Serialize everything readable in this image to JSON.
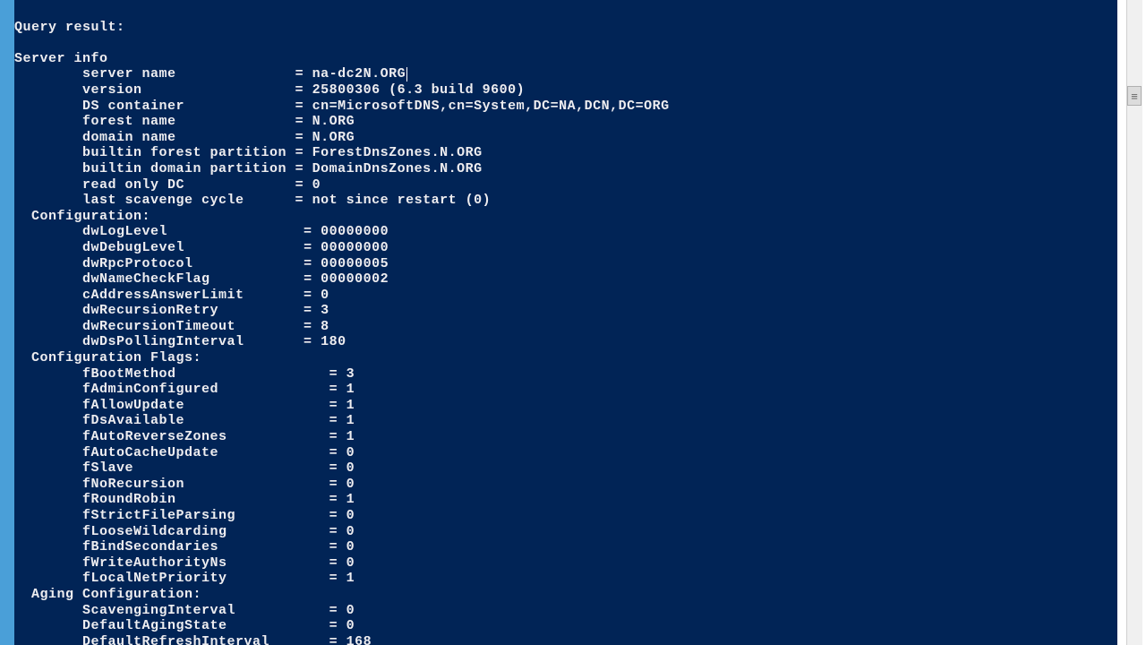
{
  "query_header": "Query result:",
  "section_server_info": "Server info",
  "server_info": {
    "server_name_label": "server name",
    "server_name_value": "na-dc2N.ORG",
    "version_label": "version",
    "version_value": "25800306 (6.3 build 9600)",
    "ds_container_label": "DS container",
    "ds_container_value": "cn=MicrosoftDNS,cn=System,DC=NA,DCN,DC=ORG",
    "forest_name_label": "forest name",
    "forest_name_value": "N.ORG",
    "domain_name_label": "domain name",
    "domain_name_value": "N.ORG",
    "builtin_forest_label": "builtin forest partition",
    "builtin_forest_value": "ForestDnsZones.N.ORG",
    "builtin_domain_label": "builtin domain partition",
    "builtin_domain_value": "DomainDnsZones.N.ORG",
    "read_only_dc_label": "read only DC",
    "read_only_dc_value": "0",
    "last_scavenge_label": "last scavenge cycle",
    "last_scavenge_value": "not since restart (0)"
  },
  "section_configuration": "Configuration:",
  "configuration": {
    "dwLogLevel_label": "dwLogLevel",
    "dwLogLevel_value": "00000000",
    "dwDebugLevel_label": "dwDebugLevel",
    "dwDebugLevel_value": "00000000",
    "dwRpcProtocol_label": "dwRpcProtocol",
    "dwRpcProtocol_value": "00000005",
    "dwNameCheckFlag_label": "dwNameCheckFlag",
    "dwNameCheckFlag_value": "00000002",
    "cAddressAnswerLimit_label": "cAddressAnswerLimit",
    "cAddressAnswerLimit_value": "0",
    "dwRecursionRetry_label": "dwRecursionRetry",
    "dwRecursionRetry_value": "3",
    "dwRecursionTimeout_label": "dwRecursionTimeout",
    "dwRecursionTimeout_value": "8",
    "dwDsPollingInterval_label": "dwDsPollingInterval",
    "dwDsPollingInterval_value": "180"
  },
  "section_config_flags": "Configuration Flags:",
  "config_flags": {
    "fBootMethod_label": "fBootMethod",
    "fBootMethod_value": "3",
    "fAdminConfigured_label": "fAdminConfigured",
    "fAdminConfigured_value": "1",
    "fAllowUpdate_label": "fAllowUpdate",
    "fAllowUpdate_value": "1",
    "fDsAvailable_label": "fDsAvailable",
    "fDsAvailable_value": "1",
    "fAutoReverseZones_label": "fAutoReverseZones",
    "fAutoReverseZones_value": "1",
    "fAutoCacheUpdate_label": "fAutoCacheUpdate",
    "fAutoCacheUpdate_value": "0",
    "fSlave_label": "fSlave",
    "fSlave_value": "0",
    "fNoRecursion_label": "fNoRecursion",
    "fNoRecursion_value": "0",
    "fRoundRobin_label": "fRoundRobin",
    "fRoundRobin_value": "1",
    "fStrictFileParsing_label": "fStrictFileParsing",
    "fStrictFileParsing_value": "0",
    "fLooseWildcarding_label": "fLooseWildcarding",
    "fLooseWildcarding_value": "0",
    "fBindSecondaries_label": "fBindSecondaries",
    "fBindSecondaries_value": "0",
    "fWriteAuthorityNs_label": "fWriteAuthorityNs",
    "fWriteAuthorityNs_value": "0",
    "fLocalNetPriority_label": "fLocalNetPriority",
    "fLocalNetPriority_value": "1"
  },
  "section_aging": "Aging Configuration:",
  "aging": {
    "ScavengingInterval_label": "ScavengingInterval",
    "ScavengingInterval_value": "0",
    "DefaultAgingState_label": "DefaultAgingState",
    "DefaultAgingState_value": "0",
    "DefaultRefreshInterval_label": "DefaultRefreshInterval",
    "DefaultRefreshInterval_value": "168"
  },
  "scroll_thumb_glyph": "≡"
}
